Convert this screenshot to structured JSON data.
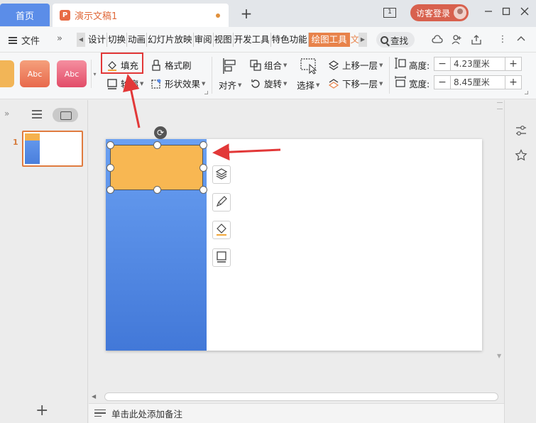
{
  "tabs": {
    "home_label": "首页",
    "doc_title": "演示文稿1",
    "doc_icon_letter": "P",
    "add_label": "+"
  },
  "titlebar": {
    "window_count": "1",
    "guest_login": "访客登录"
  },
  "menu": {
    "file_label": "文件",
    "expand_glyph": "»",
    "items": [
      "设计",
      "切换",
      "动画",
      "幻灯片放映",
      "审阅",
      "视图",
      "开发工具",
      "特色功能",
      "绘图工具",
      "文"
    ],
    "active_item": "绘图工具",
    "search_label": "查找"
  },
  "ribbon": {
    "style_samples": [
      "Abc",
      "Abc"
    ],
    "fill_label": "填充",
    "outline_label": "轮廓",
    "format_painter_label": "格式刷",
    "shape_effects_label": "形状效果",
    "align_label": "对齐",
    "group_label": "组合",
    "rotate_label": "旋转",
    "select_label": "选择",
    "bring_forward_label": "上移一层",
    "send_backward_label": "下移一层",
    "height_label": "高度:",
    "height_value": "4.23厘米",
    "width_label": "宽度:",
    "width_value": "8.45厘米"
  },
  "slides_panel": {
    "slide_number": "1",
    "add_label": "+"
  },
  "notes": {
    "placeholder": "单击此处添加备注"
  },
  "colors": {
    "accent": "#e8834b",
    "home_tab": "#5b8de8",
    "annotation_red": "#e23838",
    "shape_blue": "#4a7fdc",
    "shape_orange": "#f8b752"
  }
}
